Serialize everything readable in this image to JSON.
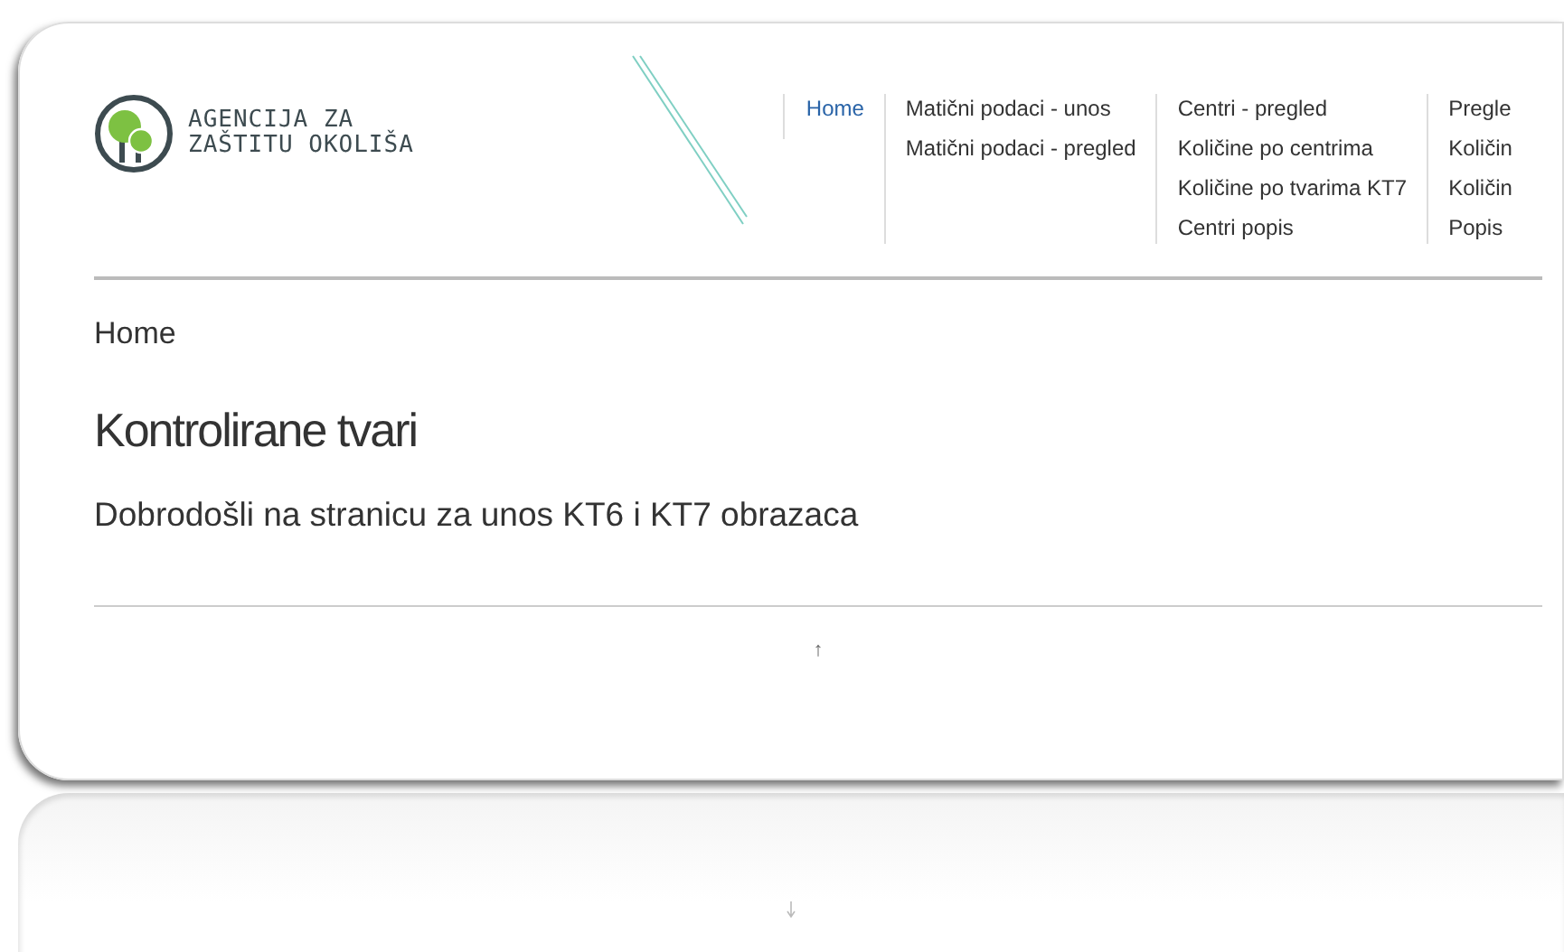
{
  "logo": {
    "lines": [
      "AGENCIJA ZA",
      "ZAŠTITU OKOLIŠA"
    ]
  },
  "menu": [
    {
      "items": [
        {
          "label": "Home",
          "selected": true
        }
      ]
    },
    {
      "items": [
        {
          "label": "Matični podaci - unos",
          "selected": false
        },
        {
          "label": "Matični podaci - pregled",
          "selected": false
        }
      ]
    },
    {
      "items": [
        {
          "label": "Centri - pregled",
          "selected": false
        },
        {
          "label": "Količine po centrima",
          "selected": false
        },
        {
          "label": "Količine po tvarima KT7",
          "selected": false
        },
        {
          "label": "Centri popis",
          "selected": false
        }
      ]
    },
    {
      "items": [
        {
          "label": "Pregle",
          "selected": false
        },
        {
          "label": "Količin",
          "selected": false
        },
        {
          "label": "Količin",
          "selected": false
        },
        {
          "label": "Popis",
          "selected": false
        }
      ]
    }
  ],
  "breadcrumb": "Home",
  "heading": "Kontrolirane tvari",
  "subtitle": "Dobrodošli na stranicu za unos KT6 i KT7 obrazaca",
  "footer": {
    "back_to_top": "↑"
  }
}
